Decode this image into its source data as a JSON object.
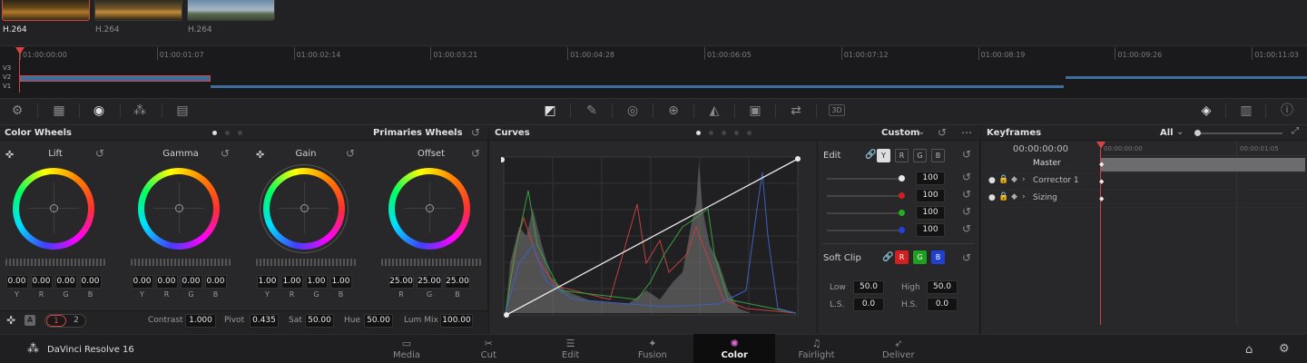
{
  "app": {
    "name": "DaVinci Resolve 16"
  },
  "clips": [
    {
      "codec": "H.264",
      "selected": true
    },
    {
      "codec": "H.264",
      "selected": false
    },
    {
      "codec": "H.264",
      "selected": false
    }
  ],
  "timeline": {
    "timecodes": [
      "01:00:00:00",
      "01:00:01:07",
      "01:00:02:14",
      "01:00:03:21",
      "01:00:04:28",
      "01:00:06:05",
      "01:00:07:12",
      "01:00:08:19",
      "01:00:09:26",
      "01:00:11:03"
    ],
    "tracks": [
      "V3",
      "V2",
      "V1"
    ]
  },
  "color_wheels": {
    "title": "Color Wheels",
    "mode": "Primaries Wheels",
    "wheels": [
      {
        "name": "Lift",
        "channels": [
          "Y",
          "R",
          "G",
          "B"
        ],
        "values": [
          "0.00",
          "0.00",
          "0.00",
          "0.00"
        ]
      },
      {
        "name": "Gamma",
        "channels": [
          "Y",
          "R",
          "G",
          "B"
        ],
        "values": [
          "0.00",
          "0.00",
          "0.00",
          "0.00"
        ]
      },
      {
        "name": "Gain",
        "channels": [
          "Y",
          "R",
          "G",
          "B"
        ],
        "values": [
          "1.00",
          "1.00",
          "1.00",
          "1.00"
        ]
      },
      {
        "name": "Offset",
        "channels": [
          "R",
          "G",
          "B"
        ],
        "values": [
          "25.00",
          "25.00",
          "25.00"
        ]
      }
    ],
    "footer": {
      "auto_label": "A",
      "pages": [
        "1",
        "2"
      ],
      "contrast_label": "Contrast",
      "contrast": "1.000",
      "pivot_label": "Pivot",
      "pivot": "0.435",
      "sat_label": "Sat",
      "sat": "50.00",
      "hue_label": "Hue",
      "hue": "50.00",
      "lummix_label": "Lum Mix",
      "lummix": "100.00"
    }
  },
  "curves": {
    "title": "Curves",
    "mode": "Custom",
    "edit": {
      "label": "Edit",
      "channel_buttons": [
        "Y",
        "R",
        "G",
        "B"
      ],
      "intensities": [
        "100",
        "100",
        "100",
        "100"
      ]
    },
    "soft_clip": {
      "label": "Soft Clip",
      "channel_buttons": [
        "R",
        "G",
        "B"
      ],
      "low_label": "Low",
      "low": "50.0",
      "high_label": "High",
      "high": "50.0",
      "ls_label": "L.S.",
      "ls": "0.0",
      "hs_label": "H.S.",
      "hs": "0.0"
    }
  },
  "keyframes": {
    "title": "Keyframes",
    "filter": "All",
    "timecode": "00:00:00:00",
    "ruler": [
      "00:00:00:00",
      "00:00:01:05"
    ],
    "rows": [
      "Master",
      "Corrector 1",
      "Sizing"
    ]
  },
  "nav": {
    "pages": [
      {
        "label": "Media",
        "icon": "media-icon"
      },
      {
        "label": "Cut",
        "icon": "cut-icon"
      },
      {
        "label": "Edit",
        "icon": "edit-icon"
      },
      {
        "label": "Fusion",
        "icon": "fusion-icon"
      },
      {
        "label": "Color",
        "icon": "color-icon"
      },
      {
        "label": "Fairlight",
        "icon": "fairlight-icon"
      },
      {
        "label": "Deliver",
        "icon": "deliver-icon"
      }
    ],
    "active": "Color"
  },
  "colors": {
    "accent_red": "#d24545",
    "bg": "#1c1c1e",
    "panel": "#28282a",
    "blue_clip": "#3d6f9e"
  }
}
